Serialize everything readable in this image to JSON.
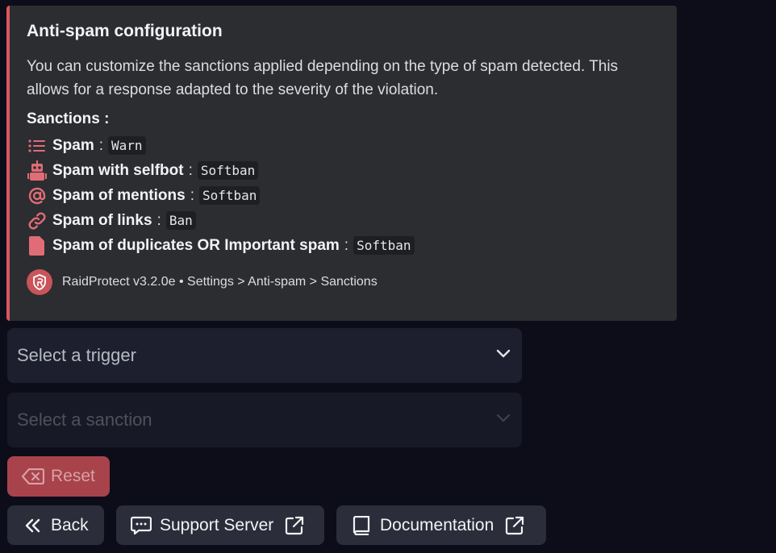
{
  "embed": {
    "title": "Anti-spam configuration",
    "description": "You can customize the sanctions applied depending on the type of spam detected. This allows for a response adapted to the severity of the violation.",
    "sanctions_title": "Sanctions :",
    "accent_color": "#d9575f",
    "items": [
      {
        "icon": "list-icon",
        "label": "Spam",
        "sep": ":",
        "value": "Warn"
      },
      {
        "icon": "robot-icon",
        "label": "Spam with selfbot",
        "sep": ":",
        "value": "Softban"
      },
      {
        "icon": "at-sign-icon",
        "label": "Spam of mentions",
        "sep": ":",
        "value": "Softban"
      },
      {
        "icon": "link-icon",
        "label": "Spam of links",
        "sep": ":",
        "value": "Ban"
      },
      {
        "icon": "file-icon",
        "label": "Spam of duplicates OR Important spam",
        "sep": ":",
        "value": "Softban"
      }
    ],
    "footer": {
      "icon": "raidprotect-logo",
      "text": "RaidProtect v3.2.0e • Settings > Anti-spam > Sanctions"
    }
  },
  "selects": {
    "trigger": {
      "placeholder": "Select a trigger",
      "disabled": false
    },
    "sanction": {
      "placeholder": "Select a sanction",
      "disabled": true
    }
  },
  "buttons": {
    "reset": "Reset",
    "back": "Back",
    "support": "Support Server",
    "docs": "Documentation"
  }
}
